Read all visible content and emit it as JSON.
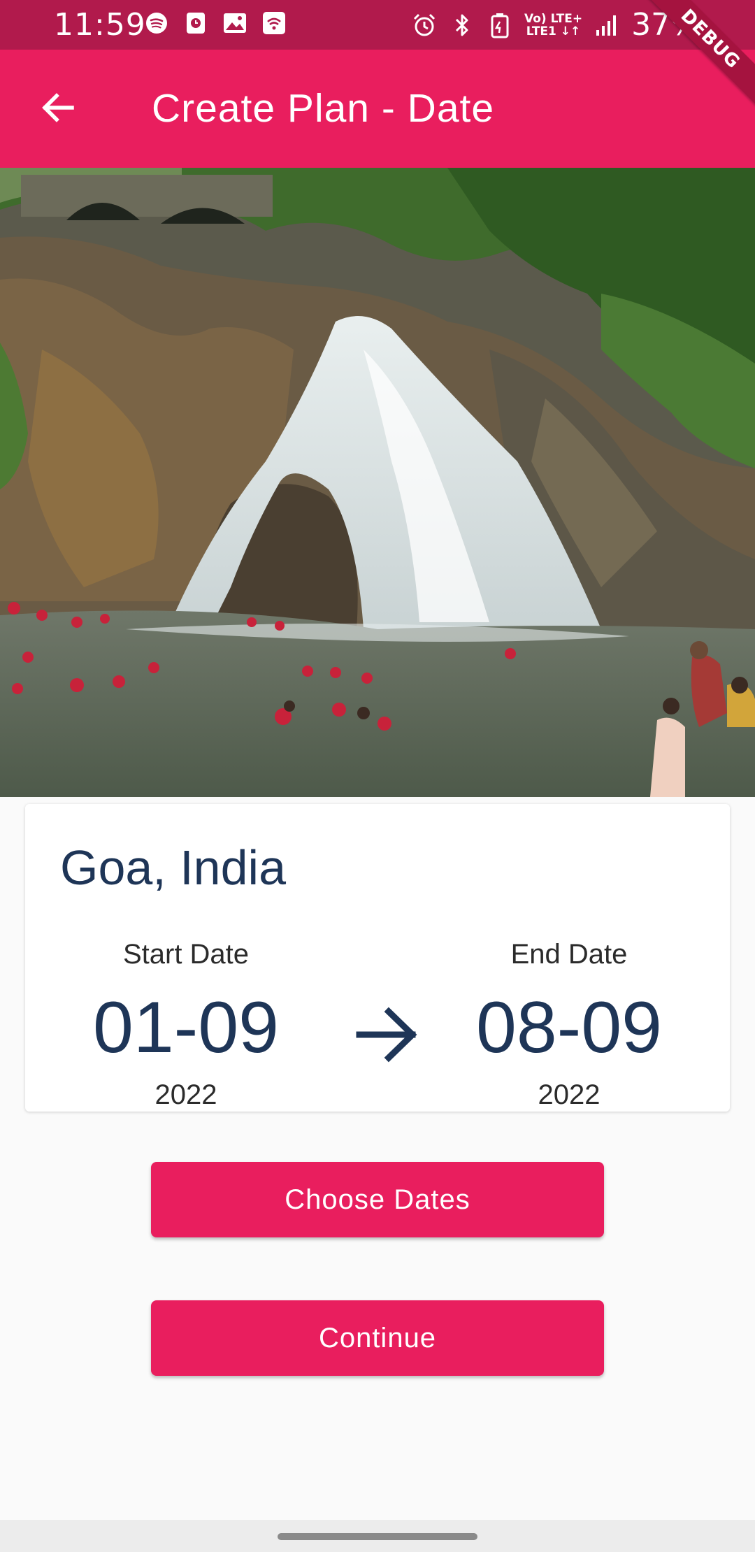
{
  "status_bar": {
    "time": "11:59",
    "left_icons": [
      "spotify-icon",
      "clock-app-icon",
      "gallery-icon",
      "wifi-hotspot-icon"
    ],
    "right_icons": [
      "alarm-icon",
      "bluetooth-icon",
      "battery-saver-icon",
      "signal-icon"
    ],
    "network_line1": "Vo) LTE+",
    "network_line2": "LTE1 ↓↑",
    "battery": "37%"
  },
  "debug_banner": "DEBUG",
  "app_bar": {
    "title": "Create Plan - Date",
    "back_icon": "arrow-back-icon",
    "background": "#e91e5e"
  },
  "hero_image": {
    "subject": "waterfall-photo"
  },
  "card": {
    "place": "Goa, India",
    "start": {
      "label": "Start Date",
      "date": "01-09",
      "year": "2022"
    },
    "end": {
      "label": "End Date",
      "date": "08-09",
      "year": "2022"
    },
    "separator_icon": "arrow-forward-icon"
  },
  "buttons": {
    "choose_dates": "Choose Dates",
    "continue": "Continue"
  },
  "colors": {
    "accent": "#e91e5e",
    "status_bar": "#b11a4c",
    "text_dark": "#1e3557"
  }
}
